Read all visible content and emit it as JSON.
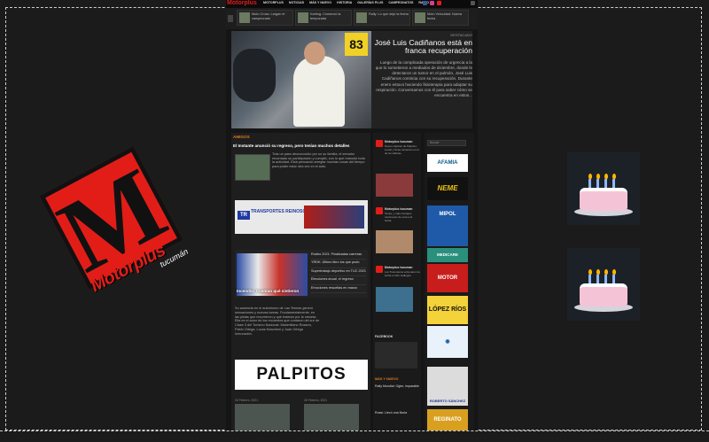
{
  "site": {
    "brand": "Motorplus",
    "menu": [
      "MOTORPLUS",
      "NOTICIAS",
      "MÁS Y NUEVO",
      "HISTORIA",
      "GALERÍAS PLUS",
      "CAMPEONATOS",
      "RADIO"
    ],
    "ticker": [
      {
        "text": "Moto Cross: Largan el campeonato"
      },
      {
        "text": "Karting: Comenzó la temporada"
      },
      {
        "text": "Rally: Lo que dejó la fecha"
      },
      {
        "text": "Moto Velocidad: Nueva fecha"
      }
    ],
    "hero": {
      "category": "DESTACADO",
      "title": "José Luis Cadiñanos está en franca recuperación",
      "body": "Luego de la complicada operación de urgencia a la que lo sometieron a mediados de diciembre, donde le detectaron un tumor en el pulmón, José Luis Cadiñanos continúa con su recuperación. Durante enero estuvo haciendo fisioterapia para adaptar su respiración. Conversamos con él para saber cómo se encuentra en estos..."
    },
    "amigos": {
      "section": "AMIGOS",
      "title": "El Instante anunció su regreso, pero tenían muchos detalles",
      "body": "Tras un paso desconocido por un su familia, el senador recordado su participación y cumplió, con lo que reanudó toda la actividad. Está pensando arreglar muchas cosas del tiempo para poder estar otra vez en el auto."
    },
    "banner_transport": {
      "label": "TRANSPORTES REINOSO",
      "icon": "TR"
    },
    "slider": {
      "caption": "Incendio: Cuentan qué sintieron",
      "list": [
        "Rodeo 2021: Finalizadas carreras",
        "YRDK: Último libro los que pudo",
        "Supertrabajo deportivo en TUC 2021",
        "Elecciones anual, el regreso",
        "Emociones resueltas en marzo"
      ]
    },
    "article_body": "Su ausencia en el autódromo de Las Termas generó sensaciones y nuevas tareas. Fundamentalmente, en las pistas que recorrieron y que trataron por la meseta. Elia es el autor de los recuerdos que contaron del sur de Clase 3 del Turismo Nacional: Maximiliano Rosano, Pablo Ortega, Lucas Moscheni y Juan Ortega Inmuración.",
    "palpitos": "PALPITOS",
    "bottom_dates": [
      "26 Febrero, 2021",
      "26 Febrero, 2021"
    ],
    "twitter": [
      {
        "name": "Motorplus tucuman",
        "text": "Nuevo capítulo de Palpitos; Lucas y Sosa remarcan el rol de la mañana..."
      },
      {
        "name": "Motorplus tucuman",
        "text": "Tenés, y más consejos tucumanos de cara a la fecha."
      },
      {
        "name": "Motorplus tucuman",
        "text": "Los Tucumanos entrenaron la fecha en Río Gallegos."
      }
    ],
    "facebook_label": "FACEBOOK",
    "news_section": "MÁS Y NUEVO",
    "news": [
      "Rally Mundial: Ogier, imparable",
      "Rossi: Llevó una Noria"
    ],
    "search_placeholder": "Buscar",
    "ads": [
      "AFAMIA",
      "NEME",
      "MIPOL",
      "MEDICARE",
      "MOTOR",
      "LÓPEZ RÍOS",
      "",
      "ROBERTO SÁNCHEZ",
      "REGINATO"
    ],
    "logo": {
      "word": "Motorplus",
      "sub": "tucumán",
      "letter": "M"
    }
  }
}
